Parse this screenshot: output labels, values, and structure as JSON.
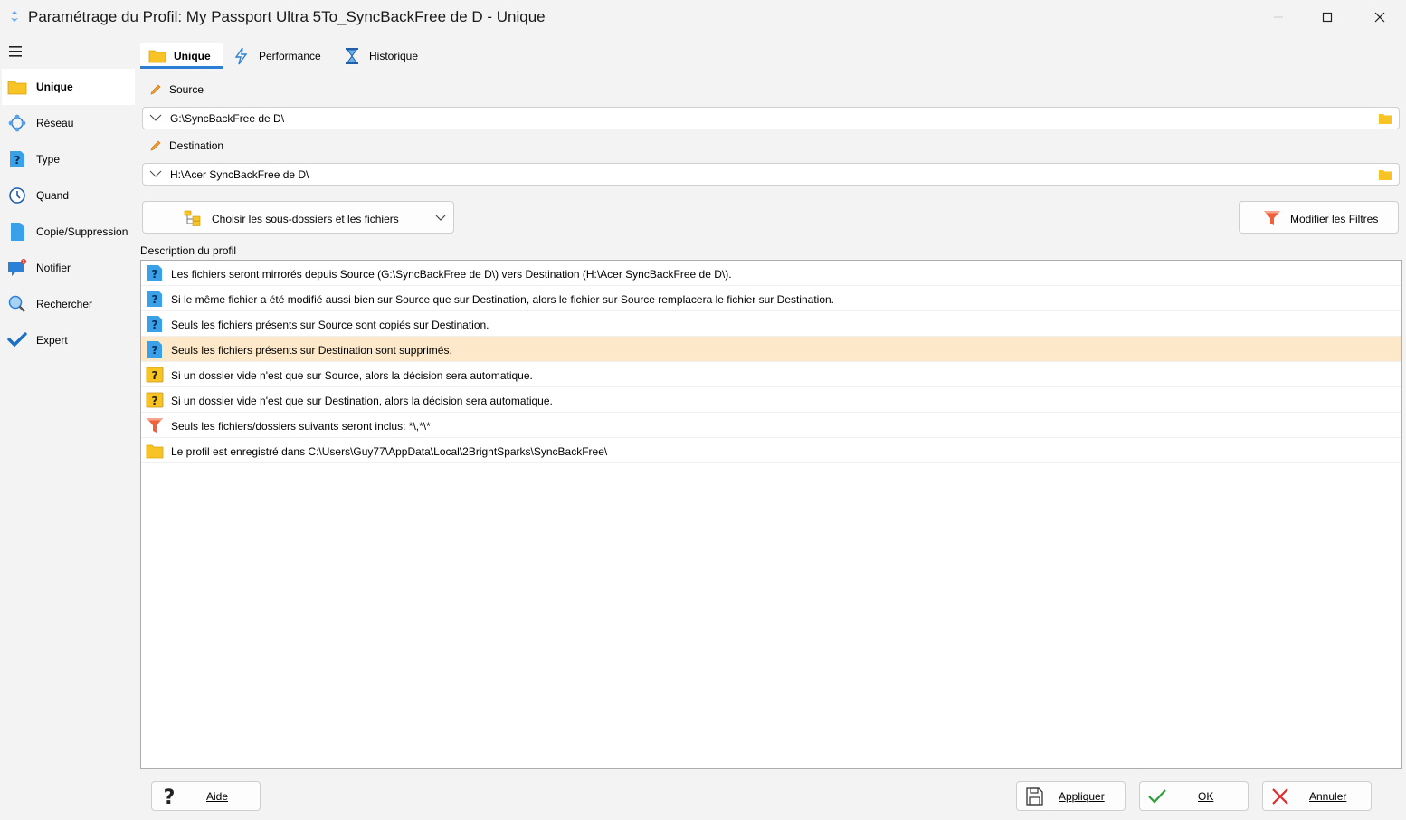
{
  "window": {
    "title": "Paramétrage du Profil: My Passport Ultra 5To_SyncBackFree de D - Unique"
  },
  "sidebar": {
    "items": [
      {
        "label": "Unique",
        "icon": "folder-icon",
        "active": true
      },
      {
        "label": "Réseau",
        "icon": "network-icon"
      },
      {
        "label": "Type",
        "icon": "question-doc-icon"
      },
      {
        "label": "Quand",
        "icon": "clock-icon"
      },
      {
        "label": "Copie/Suppression",
        "icon": "document-icon"
      },
      {
        "label": "Notifier",
        "icon": "notification-icon",
        "badge": "1"
      },
      {
        "label": "Rechercher",
        "icon": "magnifier-icon"
      },
      {
        "label": "Expert",
        "icon": "checkmark-icon"
      }
    ]
  },
  "tabs": [
    {
      "label": "Unique",
      "icon": "folder-icon",
      "active": true
    },
    {
      "label": "Performance",
      "icon": "lightning-icon"
    },
    {
      "label": "Historique",
      "icon": "hourglass-icon"
    }
  ],
  "source": {
    "label": "Source",
    "value": "G:\\SyncBackFree de D\\"
  },
  "destination": {
    "label": "Destination",
    "value": "H:\\Acer SyncBackFree de D\\"
  },
  "buttons": {
    "choose_folders": "Choisir les sous-dossiers et les fichiers",
    "modify_filters": "Modifier les Filtres",
    "help": "Aide",
    "apply": "Appliquer",
    "ok": "OK",
    "cancel": "Annuler"
  },
  "description": {
    "title": "Description du profil",
    "rows": [
      {
        "text": "Les fichiers seront mirrorés depuis Source (G:\\SyncBackFree de D\\) vers Destination (H:\\Acer SyncBackFree de D\\).",
        "icon": "blue-question-icon"
      },
      {
        "text": "Si le même fichier a été modifié aussi bien sur Source que sur Destination, alors le fichier sur Source remplacera le fichier sur Destination.",
        "icon": "blue-question-icon"
      },
      {
        "text": "Seuls les fichiers présents sur Source sont copiés sur Destination.",
        "icon": "blue-question-icon"
      },
      {
        "text": "Seuls les fichiers présents sur Destination sont supprimés.",
        "icon": "blue-question-icon",
        "selected": true
      },
      {
        "text": "Si un dossier vide n'est que sur Source, alors la décision sera automatique.",
        "icon": "yellow-question-icon"
      },
      {
        "text": "Si un dossier vide n'est que sur Destination, alors la décision sera automatique.",
        "icon": "yellow-question-icon"
      },
      {
        "text": "Seuls les fichiers/dossiers suivants seront inclus: *\\,*\\*",
        "icon": "funnel-icon"
      },
      {
        "text": "Le profil est enregistré dans C:\\Users\\Guy77\\AppData\\Local\\2BrightSparks\\SyncBackFree\\",
        "icon": "folder-icon"
      }
    ]
  },
  "colors": {
    "accent": "#2b7fd6",
    "selected_row": "#fde9c9",
    "folder_yellow": "#f7c325"
  }
}
